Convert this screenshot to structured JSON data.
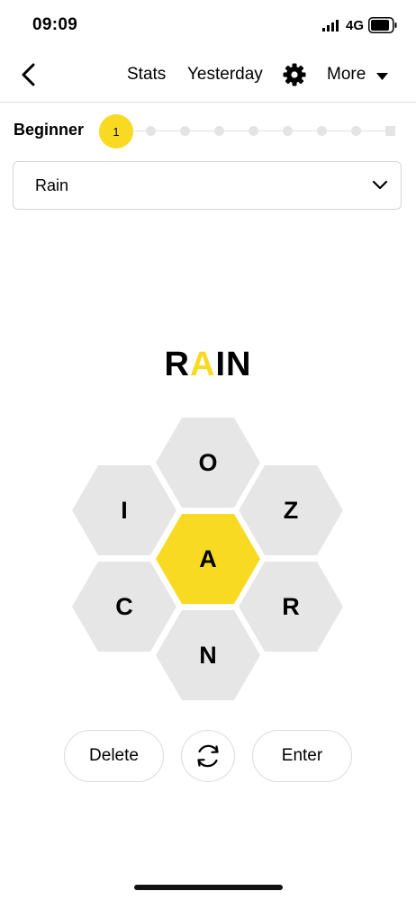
{
  "status_bar": {
    "time": "09:09",
    "network": "4G",
    "icons": [
      "signal-icon",
      "battery-icon"
    ]
  },
  "nav": {
    "back_icon": "back-chevron-icon",
    "stats_label": "Stats",
    "yesterday_label": "Yesterday",
    "settings_icon": "gear-icon",
    "more_label": "More",
    "more_icon": "caret-down-icon"
  },
  "progress": {
    "rank_label": "Beginner",
    "score": "1",
    "total_steps": 9,
    "current_step": 1
  },
  "word_list": {
    "selected": "Rain",
    "icon": "chevron-down-icon"
  },
  "current_word": {
    "before": "R",
    "center": "A",
    "after": "IN"
  },
  "hive": {
    "center_letter": "A",
    "top": "O",
    "upper_left": "I",
    "upper_right": "Z",
    "lower_left": "C",
    "lower_right": "R",
    "bottom": "N"
  },
  "actions": {
    "delete_label": "Delete",
    "shuffle_icon": "shuffle-icon",
    "enter_label": "Enter"
  },
  "colors": {
    "accent_yellow": "#f7da21",
    "hex_gray": "#e6e6e6",
    "border": "#dcdcdc"
  }
}
